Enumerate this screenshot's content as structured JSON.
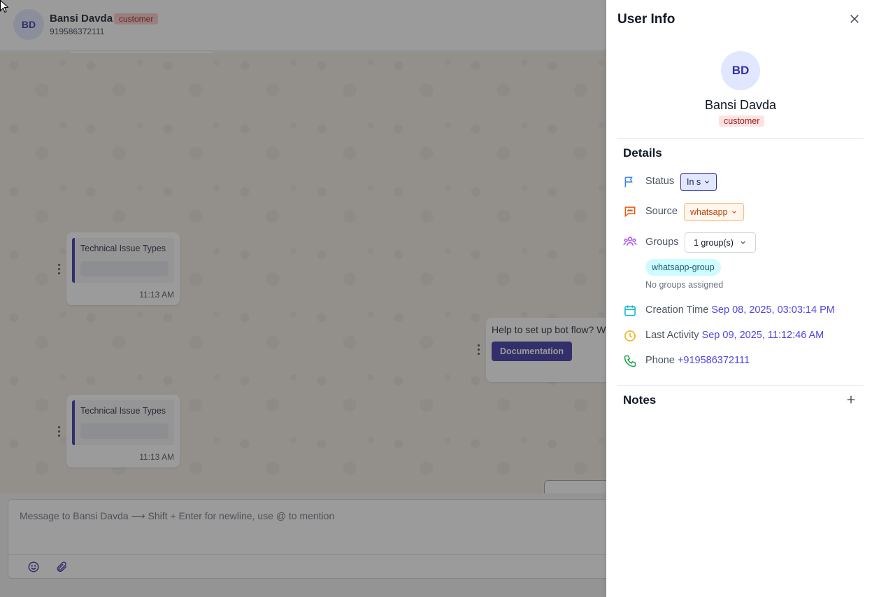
{
  "chat": {
    "header": {
      "avatar_initials": "BD",
      "name": "Bansi Davda",
      "badge": "customer",
      "phone": "919586372111"
    },
    "messages": [
      {
        "title": "Technical Issue Types",
        "time": "11:13 AM"
      },
      {
        "title": "Technical Issue Types",
        "time": "11:13 AM"
      }
    ],
    "bot_message": {
      "text": "Help to set up bot flow? W",
      "button_label": "Documentation"
    },
    "composer": {
      "placeholder": "Message to Bansi Davda ⟶ Shift + Enter for newline, use @ to mention"
    }
  },
  "panel": {
    "title": "User Info",
    "avatar_initials": "BD",
    "name": "Bansi Davda",
    "badge": "customer",
    "details_title": "Details",
    "status": {
      "label": "Status",
      "value": "In s"
    },
    "source": {
      "label": "Source",
      "value": "whatsapp"
    },
    "groups": {
      "label": "Groups",
      "value": "1 group(s)",
      "chip": "whatsapp-group",
      "empty_text": "No groups assigned"
    },
    "creation_time": {
      "label": "Creation Time",
      "value": "Sep 08, 2025, 03:03:14 PM"
    },
    "last_activity": {
      "label": "Last Activity",
      "value": "Sep 09, 2025, 11:12:46 AM"
    },
    "phone": {
      "label": "Phone",
      "value": "+919586372111"
    },
    "notes_title": "Notes"
  },
  "colors": {
    "accent": "#3730a3",
    "link": "#4f46e5",
    "badge_bg": "#fecaca",
    "source_orange": "#ea580c",
    "groups_purple": "#a855f7",
    "time_cyan": "#06b6d4",
    "activity_yellow": "#eab308",
    "phone_green": "#16a34a"
  },
  "icons": {
    "close": "close-icon",
    "status": "flag-icon",
    "source": "chat-bubble-icon",
    "groups": "users-icon",
    "creation": "calendar-icon",
    "activity": "clock-icon",
    "phone": "phone-icon",
    "notes_add": "plus-icon",
    "emoji": "smiley-icon",
    "attach": "paperclip-icon"
  }
}
